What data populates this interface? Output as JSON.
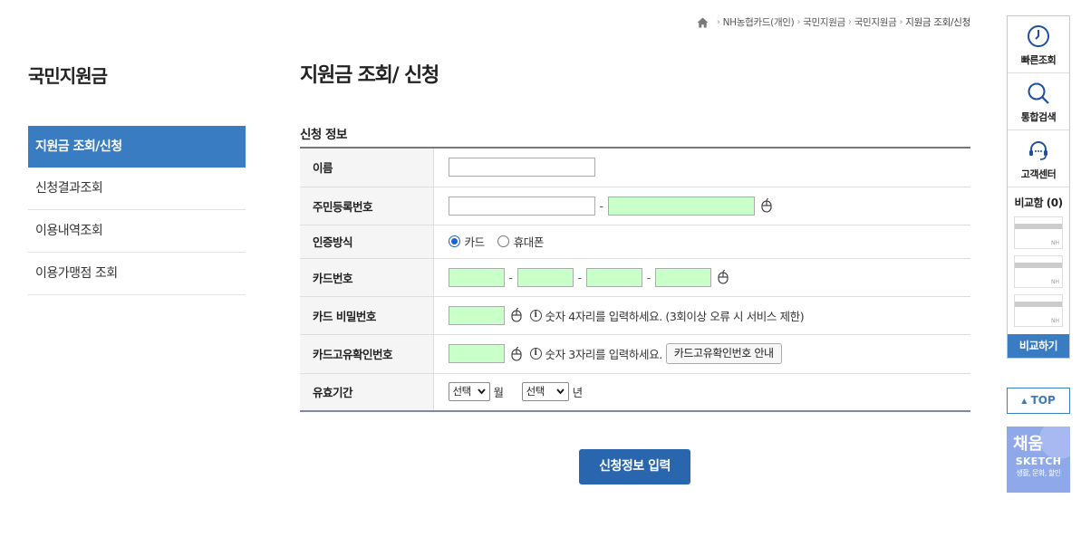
{
  "breadcrumb": {
    "items": [
      "NH농협카드(개인)",
      "국민지원금",
      "국민지원금"
    ],
    "current": "지원금 조회/신청"
  },
  "sidebar": {
    "title": "국민지원금",
    "items": [
      {
        "label": "지원금 조회/신청"
      },
      {
        "label": "신청결과조회"
      },
      {
        "label": "이용내역조회"
      },
      {
        "label": "이용가맹점 조회"
      }
    ]
  },
  "main": {
    "title": "지원금 조회/ 신청",
    "section_title": "신청 정보",
    "rows": {
      "name": {
        "label": "이름",
        "value": ""
      },
      "rrn": {
        "label": "주민등록번호",
        "front": "",
        "back": "",
        "sep": "-"
      },
      "auth": {
        "label": "인증방식",
        "options": [
          "카드",
          "휴대폰"
        ],
        "selected": "카드"
      },
      "card_number": {
        "label": "카드번호",
        "sep": "-"
      },
      "card_pw": {
        "label": "카드 비밀번호",
        "note": "숫자 4자리를 입력하세요. (3회이상 오류 시 서비스 제한)"
      },
      "cvc": {
        "label": "카드고유확인번호",
        "note": "숫자 3자리를 입력하세요.",
        "guide_button": "카드고유확인번호 안내"
      },
      "expiry": {
        "label": "유효기간",
        "month_select": "선택",
        "month_unit": "월",
        "year_select": "선택",
        "year_unit": "년"
      }
    },
    "info_glyph": "i",
    "submit_label": "신청정보 입력"
  },
  "quickbar": {
    "items": [
      {
        "label": "빠른조회",
        "icon": "clock-icon"
      },
      {
        "label": "통합검색",
        "icon": "search-icon"
      },
      {
        "label": "고객센터",
        "icon": "headset-icon"
      }
    ],
    "compare_title": "비교함 (0)",
    "compare_slot_mark": "NH",
    "compare_button": "비교하기",
    "top_label": "TOP",
    "banner": {
      "line1": "채움",
      "line2": "SKETCH",
      "line3": "생활, 문화, 할인"
    }
  },
  "colors": {
    "accent": "#3a7cc2",
    "submit": "#2a66ad",
    "secure_input": "#c9ffc9",
    "banner": "#8ea8ea"
  }
}
